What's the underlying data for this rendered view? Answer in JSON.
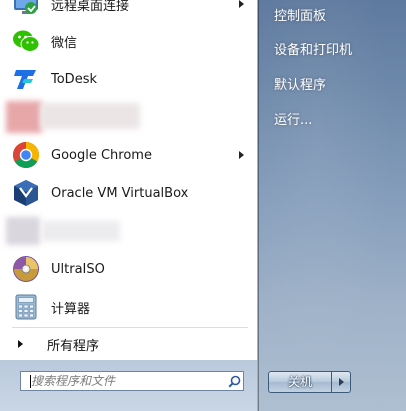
{
  "left_items": [
    {
      "label": "远程桌面连接",
      "icon": "remote-desktop-icon",
      "has_submenu": true
    },
    {
      "label": "微信",
      "icon": "wechat-icon",
      "has_submenu": false
    },
    {
      "label": "ToDesk",
      "icon": "todesk-icon",
      "has_submenu": false
    },
    {
      "label": "",
      "icon": "blurred-app-icon",
      "has_submenu": false
    },
    {
      "label": "Google Chrome",
      "icon": "chrome-icon",
      "has_submenu": true
    },
    {
      "label": "Oracle VM VirtualBox",
      "icon": "virtualbox-icon",
      "has_submenu": false
    },
    {
      "label": "",
      "icon": "blurred-app-icon",
      "has_submenu": false
    },
    {
      "label": "UltraISO",
      "icon": "ultraiso-icon",
      "has_submenu": false
    },
    {
      "label": "计算器",
      "icon": "calculator-icon",
      "has_submenu": false
    }
  ],
  "all_programs": "所有程序",
  "search": {
    "placeholder": "搜索程序和文件"
  },
  "right_items": [
    {
      "label": "控制面板"
    },
    {
      "label": "设备和打印机"
    },
    {
      "label": "默认程序"
    },
    {
      "label": "运行..."
    }
  ],
  "shutdown": {
    "label": "关机"
  }
}
